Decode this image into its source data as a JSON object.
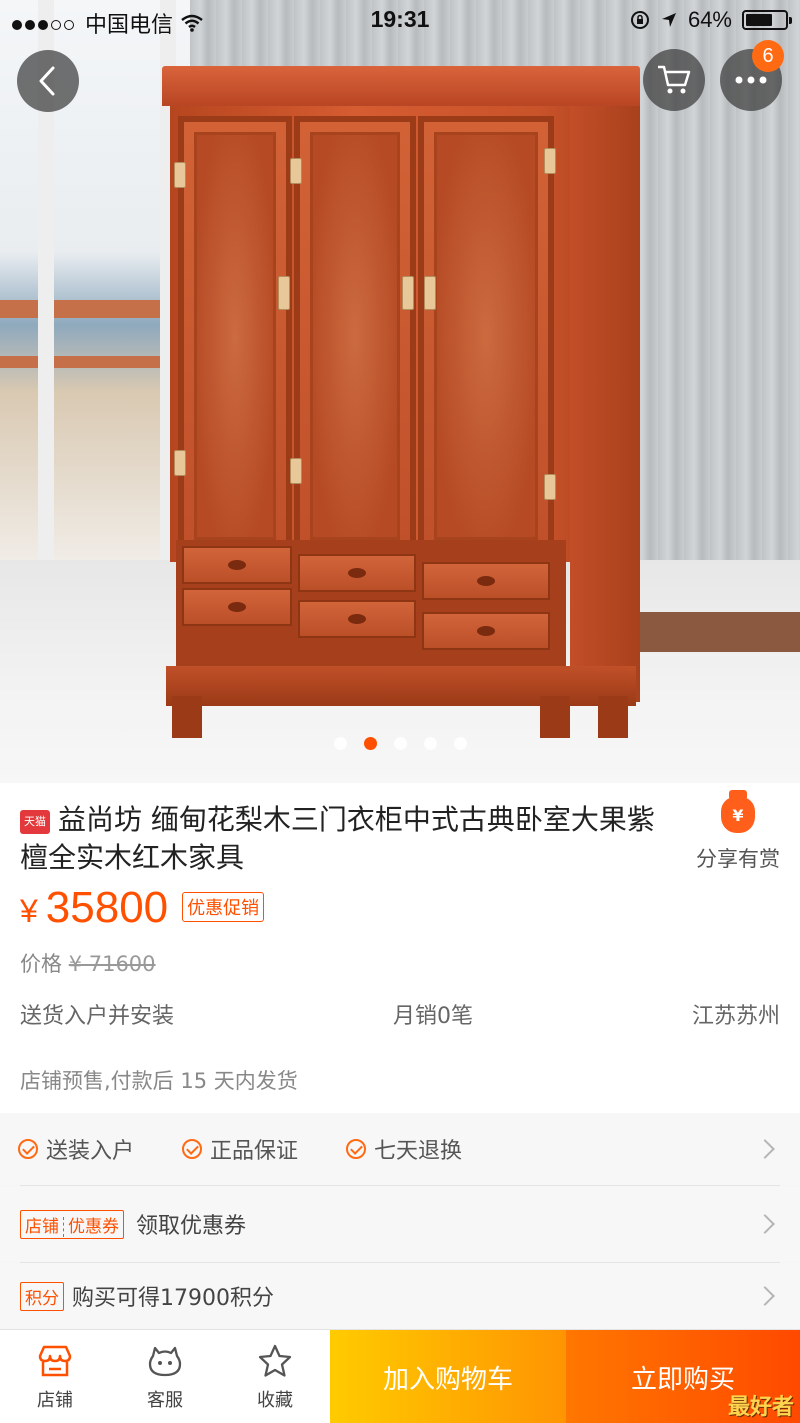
{
  "status_bar": {
    "carrier": "中国电信",
    "time": "19:31",
    "battery": "64%"
  },
  "hero": {
    "cart_badge": "6",
    "pager_count": 5,
    "pager_active": 2
  },
  "product": {
    "platform_tag": "天猫",
    "title": "益尚坊 缅甸花梨木三门衣柜中式古典卧室大果紫檀全实木红木家具",
    "share_label": "分享有赏",
    "share_icon_text": "¥",
    "currency": "¥",
    "price": "35800",
    "promo_tag": "优惠促销",
    "orig_label": "价格",
    "orig_price": "¥ 71600",
    "delivery": "送货入户并安装",
    "monthly_sales": "月销0笔",
    "location": "江苏苏州",
    "presale": "店铺预售,付款后 15 天内发货"
  },
  "services": [
    {
      "label": "送装入户"
    },
    {
      "label": "正品保证"
    },
    {
      "label": "七天退换"
    }
  ],
  "coupon": {
    "tag_left": "店铺",
    "tag_right": "优惠券",
    "text": "领取优惠券"
  },
  "points": {
    "tag": "积分",
    "text": "购买可得17900积分"
  },
  "bottom_bar": {
    "shop": "店铺",
    "service": "客服",
    "favorite": "收藏",
    "add_to_cart": "加入购物车",
    "buy_now": "立即购买",
    "watermark": "最好者"
  },
  "colors": {
    "accent": "#ff5000",
    "cart_button": "#ffa800",
    "buy_button": "#ff5000"
  }
}
